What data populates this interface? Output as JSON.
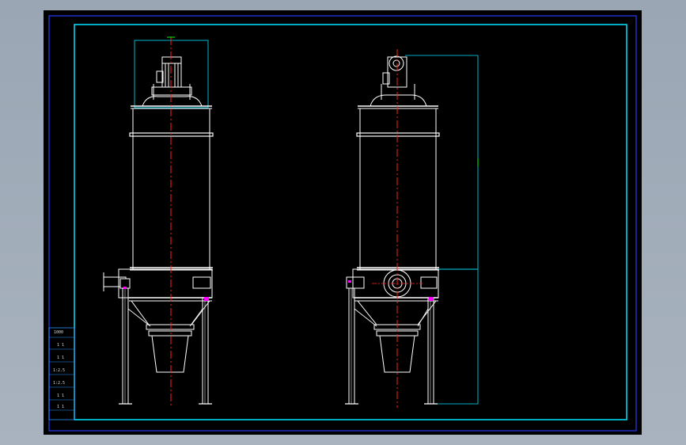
{
  "drawing": {
    "background": "#000000",
    "viewport_bg": "#a3adb9",
    "colors": {
      "outer_border": "#2030c8",
      "inner_border": "#00e5ff",
      "outline": "#ffffff",
      "centerline": "#ff2020",
      "dimension": "#00e5ff",
      "accent_magenta": "#ff00ff",
      "accent_green": "#00ff00"
    },
    "views": [
      {
        "name": "front-view"
      },
      {
        "name": "side-view"
      }
    ],
    "title_block": {
      "rows": [
        "1000",
        "1 1",
        "1 1",
        "1:2.5",
        "1:2.5",
        "1 1",
        "1 1"
      ]
    }
  }
}
